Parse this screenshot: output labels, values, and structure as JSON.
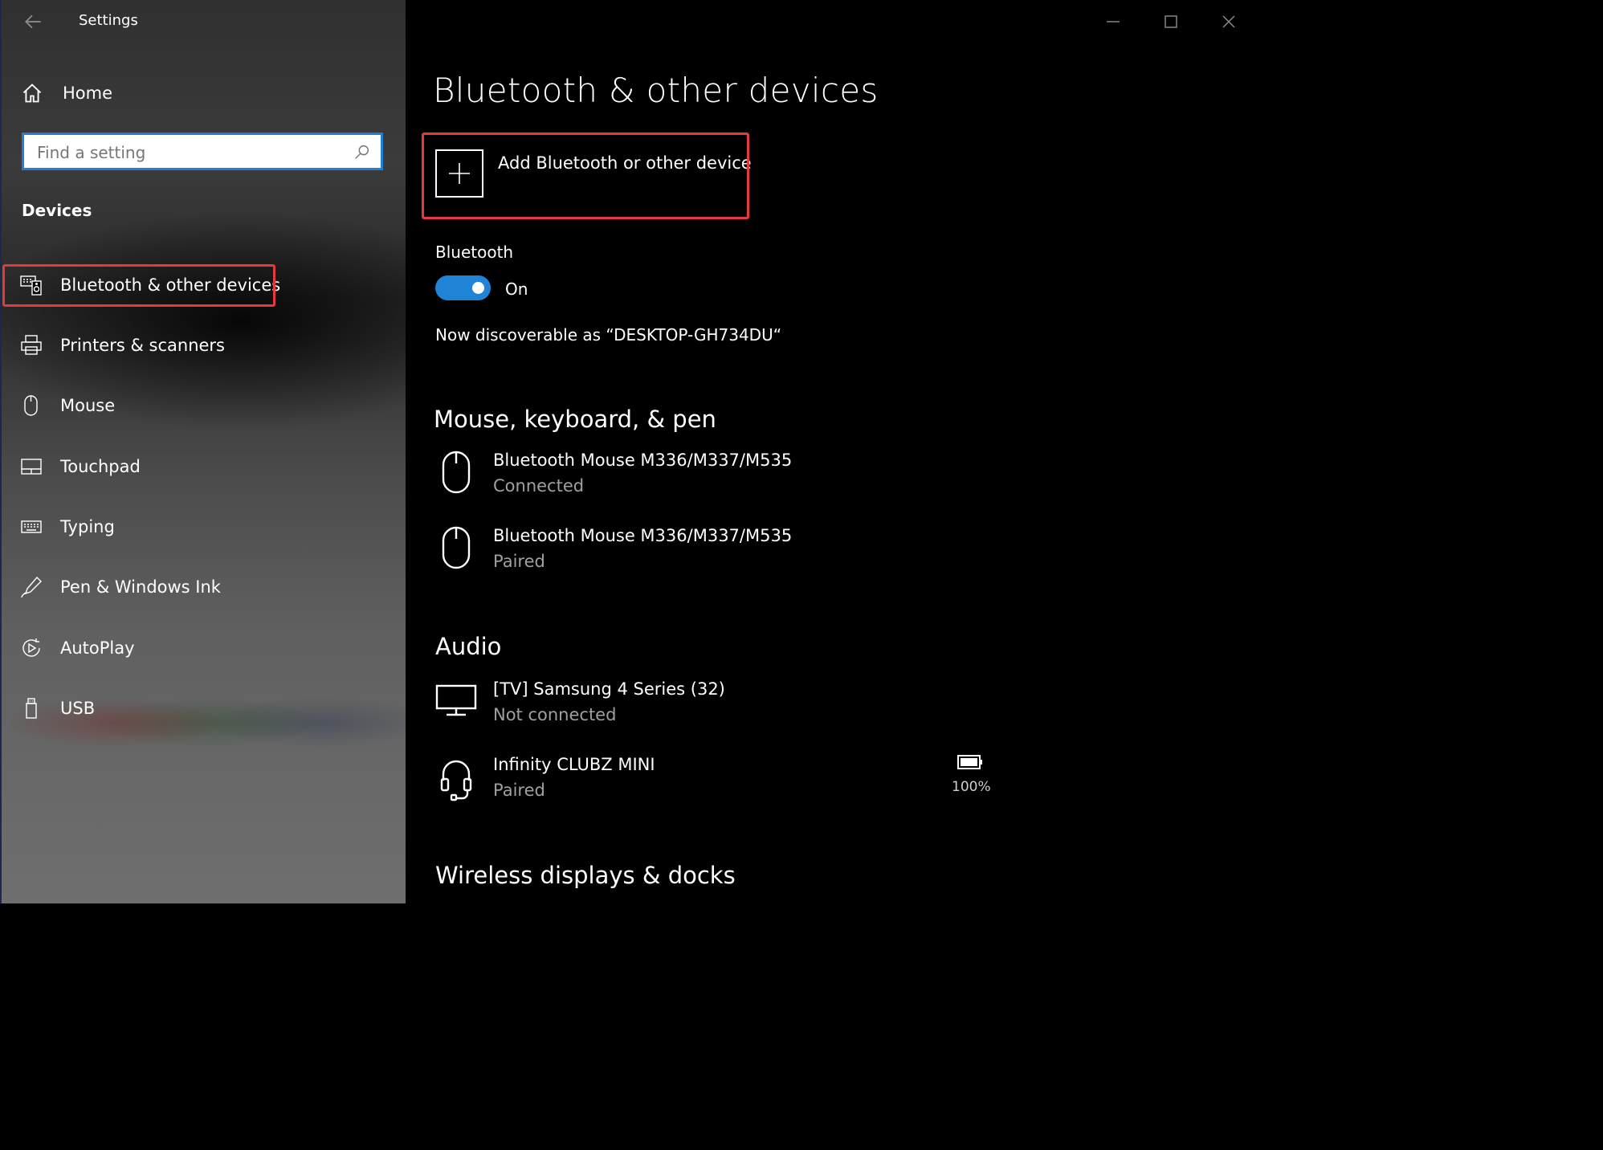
{
  "window": {
    "title": "Settings"
  },
  "sidebar": {
    "home_label": "Home",
    "search": {
      "placeholder": "Find a setting"
    },
    "section_title": "Devices",
    "items": [
      {
        "label": "Bluetooth & other devices",
        "icon": "bluetooth-devices-icon",
        "selected": true
      },
      {
        "label": "Printers & scanners",
        "icon": "printer-icon"
      },
      {
        "label": "Mouse",
        "icon": "mouse-icon"
      },
      {
        "label": "Touchpad",
        "icon": "touchpad-icon"
      },
      {
        "label": "Typing",
        "icon": "keyboard-icon"
      },
      {
        "label": "Pen & Windows Ink",
        "icon": "pen-icon"
      },
      {
        "label": "AutoPlay",
        "icon": "autoplay-icon"
      },
      {
        "label": "USB",
        "icon": "usb-icon"
      }
    ]
  },
  "main": {
    "title": "Bluetooth & other devices",
    "add_device_label": "Add Bluetooth or other device",
    "bluetooth": {
      "label": "Bluetooth",
      "toggle_state": "On",
      "enabled": true,
      "discoverable_text": "Now discoverable as “DESKTOP-GH734DU“"
    },
    "sections": [
      {
        "title": "Mouse, keyboard, & pen",
        "devices": [
          {
            "name": "Bluetooth Mouse M336/M337/M535",
            "status": "Connected",
            "icon": "mouse-icon"
          },
          {
            "name": "Bluetooth Mouse M336/M337/M535",
            "status": "Paired",
            "icon": "mouse-icon"
          }
        ]
      },
      {
        "title": "Audio",
        "devices": [
          {
            "name": "[TV] Samsung 4 Series (32)",
            "status": "Not connected",
            "icon": "monitor-icon"
          },
          {
            "name": "Infinity CLUBZ MINI",
            "status": "Paired",
            "icon": "headset-icon",
            "battery": "100%"
          }
        ]
      },
      {
        "title": "Wireless displays & docks",
        "devices": []
      }
    ]
  },
  "colors": {
    "accent": "#1f84d6",
    "highlight": "#e23b3b",
    "secondary_text": "#a0a0a0",
    "background": "#000000"
  }
}
